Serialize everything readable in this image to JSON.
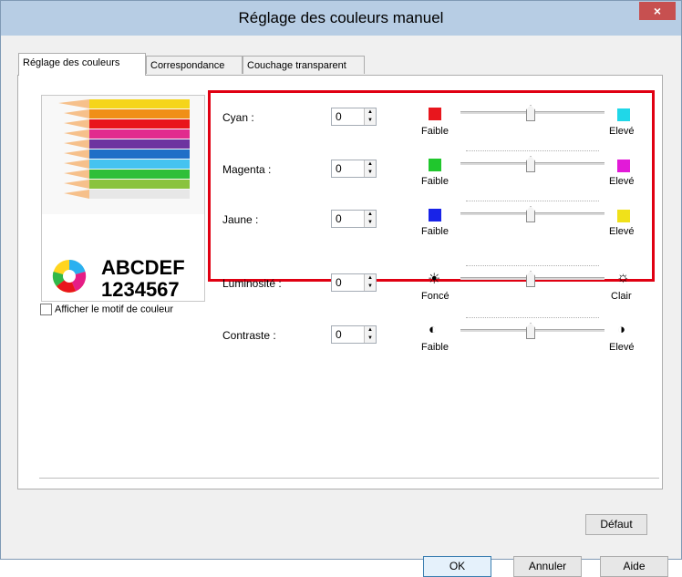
{
  "window": {
    "title": "Réglage des couleurs manuel",
    "close_label": "×"
  },
  "tabs": [
    {
      "label": "Réglage des couleurs",
      "active": true
    },
    {
      "label": "Correspondance",
      "active": false
    },
    {
      "label": "Couchage transparent",
      "active": false
    }
  ],
  "preview": {
    "text_line1": "ABCDEF",
    "text_line2": "1234567",
    "show_pattern_label": "Afficher le motif de couleur",
    "show_pattern_checked": false
  },
  "controls": [
    {
      "key": "cyan",
      "label": "Cyan :",
      "value": "0",
      "low_color": "#e8161d",
      "high_color": "#20d7e8",
      "low_label": "Faible",
      "high_label": "Elevé",
      "position": 0.5,
      "low_icon": "red-square-icon",
      "high_icon": "cyan-square-icon"
    },
    {
      "key": "magenta",
      "label": "Magenta :",
      "value": "0",
      "low_color": "#20c72d",
      "high_color": "#e21ad8",
      "low_label": "Faible",
      "high_label": "Elevé",
      "position": 0.5,
      "low_icon": "green-square-icon",
      "high_icon": "magenta-square-icon"
    },
    {
      "key": "jaune",
      "label": "Jaune :",
      "value": "0",
      "low_color": "#1823e8",
      "high_color": "#f0e11a",
      "low_label": "Faible",
      "high_label": "Elevé",
      "position": 0.5,
      "low_icon": "blue-square-icon",
      "high_icon": "yellow-square-icon"
    },
    {
      "key": "luminosite",
      "label": "Luminosité :",
      "value": "0",
      "low_label": "Foncé",
      "high_label": "Clair",
      "position": 0.5,
      "low_icon": "dark-sun-icon",
      "high_icon": "light-sun-icon"
    },
    {
      "key": "contraste",
      "label": "Contraste :",
      "value": "0",
      "low_label": "Faible",
      "high_label": "Elevé",
      "position": 0.5,
      "low_icon": "half-circle-icon",
      "high_icon": "contrast-circle-icon"
    }
  ],
  "buttons": {
    "default": "Défaut",
    "ok": "OK",
    "cancel": "Annuler",
    "help": "Aide"
  },
  "colors": {
    "highlight": "#e00012",
    "titlebar": "#b7cde4"
  }
}
